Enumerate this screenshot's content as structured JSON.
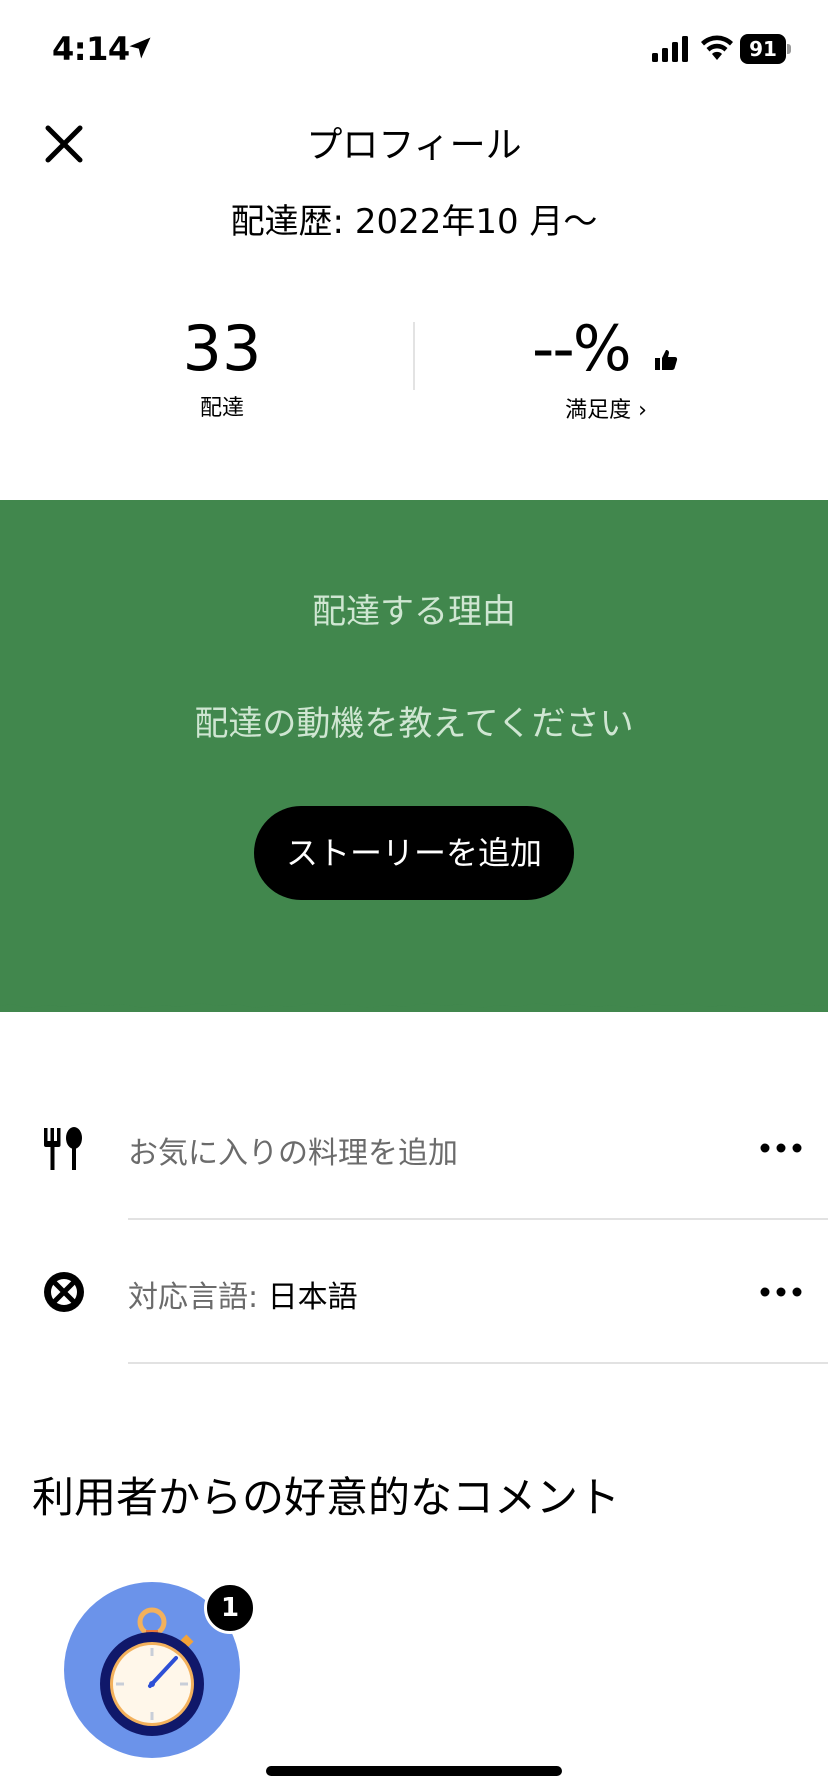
{
  "status_bar": {
    "time": "4:14",
    "battery": "91"
  },
  "header": {
    "title": "プロフィール",
    "delivery_since": "配達歴: 2022年10 月〜"
  },
  "stats": {
    "deliveries_value": "33",
    "deliveries_label": "配達",
    "satisfaction_value": "--%",
    "satisfaction_label": "満足度 ›"
  },
  "story": {
    "title": "配達する理由",
    "prompt": "配達の動機を教えてください",
    "button_label": "ストーリーを追加",
    "background_color": "#41874d"
  },
  "rows": [
    {
      "icon": "utensils-icon",
      "label": "お気に入りの料理を追加",
      "value": ""
    },
    {
      "icon": "language-icon",
      "label": "対応言語: ",
      "value": "日本語"
    }
  ],
  "comments": {
    "heading": "利用者からの好意的なコメント",
    "badge_icon": "stopwatch-icon",
    "badge_count": "1"
  }
}
